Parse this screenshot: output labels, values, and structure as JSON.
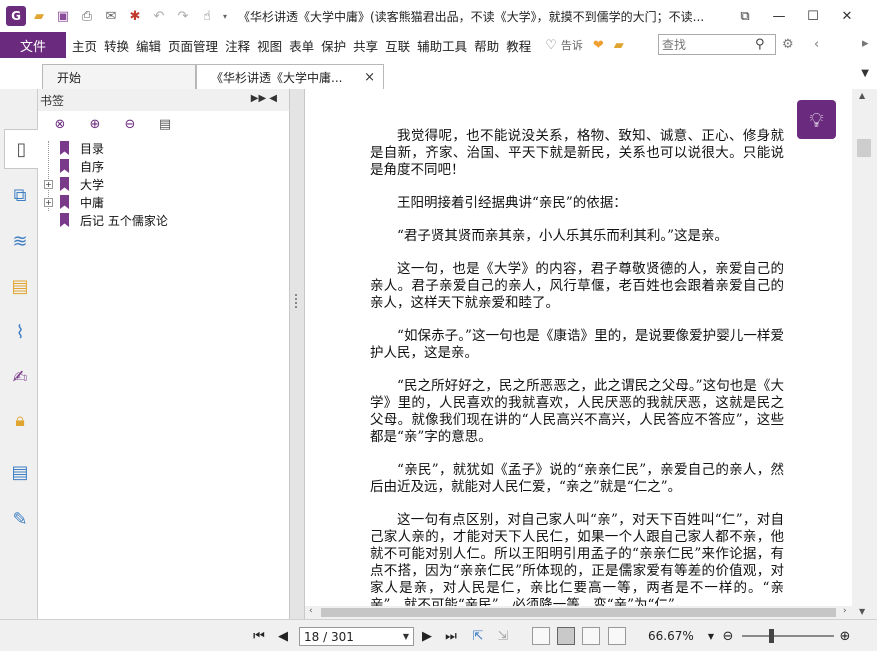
{
  "titlebar": {
    "app_icon": "G",
    "title": "《华杉讲透《大学中庸》(读客熊猫君出品，不读《大学》，就摸不到儒学的大门；不读...",
    "quick_access": [
      "open-folder-icon",
      "save-icon",
      "print-icon",
      "email-icon",
      "new-icon",
      "undo-icon",
      "redo-icon",
      "hand-tool-icon"
    ],
    "window_controls": [
      "restore-icon",
      "minimize-icon",
      "maximize-icon",
      "close-icon"
    ]
  },
  "menubar": {
    "file_label": "文件",
    "items": [
      "主页",
      "转换",
      "编辑",
      "页面管理",
      "注释",
      "视图",
      "表单",
      "保护",
      "共享",
      "互联",
      "辅助工具",
      "帮助",
      "教程"
    ],
    "tell_me": "告诉",
    "search_placeholder": "查找"
  },
  "tabs": [
    {
      "label": "开始"
    },
    {
      "label": "《华杉讲透《大学中庸...",
      "close": "×"
    }
  ],
  "bookmark_panel": {
    "title": "书签",
    "items": [
      {
        "label": "目录",
        "expandable": false
      },
      {
        "label": "自序",
        "expandable": false
      },
      {
        "label": "大学",
        "expandable": true
      },
      {
        "label": "中庸",
        "expandable": true
      },
      {
        "label": "后记 五个儒家论",
        "expandable": false
      }
    ]
  },
  "document": {
    "paragraphs": [
      "我觉得呢，也不能说没关系，格物、致知、诚意、正心、修身就是自新，齐家、治国、平天下就是新民，关系也可以说很大。只能说是角度不同吧！",
      "王阳明接着引经据典讲“亲民”的依据：",
      "“君子贤其贤而亲其亲，小人乐其乐而利其利。”这是亲。",
      "这一句，也是《大学》的内容，君子尊敬贤德的人，亲爱自己的亲人。君子亲爱自己的亲人，风行草偃，老百姓也会跟着亲爱自己的亲人，这样天下就亲爱和睦了。",
      "“如保赤子。”这一句也是《康诰》里的，是说要像爱护婴儿一样爱护人民，这是亲。",
      "“民之所好好之，民之所恶恶之，此之谓民之父母。”这句也是《大学》里的，人民喜欢的我就喜欢，人民厌恶的我就厌恶，这就是民之父母。就像我们现在讲的“人民高兴不高兴，人民答应不答应”，这些都是“亲”字的意思。",
      "“亲民”，就犹如《孟子》说的“亲亲仁民”，亲爱自己的亲人，然后由近及远，就能对人民仁爱，“亲之”就是“仁之”。",
      "这一句有点区别，对自己家人叫“亲”，对天下百姓叫“仁”，对自己家人亲的，才能对天下人民仁，如果一个人跟自己家人都不亲，他就不可能对别人仁。所以王阳明引用孟子的“亲亲仁民”来作论据，有点不搭，因为“亲亲仁民”所体现的，正是儒家爱有等差的价值观，对家人是亲，对人民是仁，亲比仁要高一等，两者是不一样的。“亲亲”，就不可能“亲民”，必须降一等，变“亲”为“仁”。"
    ]
  },
  "statusbar": {
    "page_display": "18 / 301",
    "zoom": "66.67%"
  }
}
